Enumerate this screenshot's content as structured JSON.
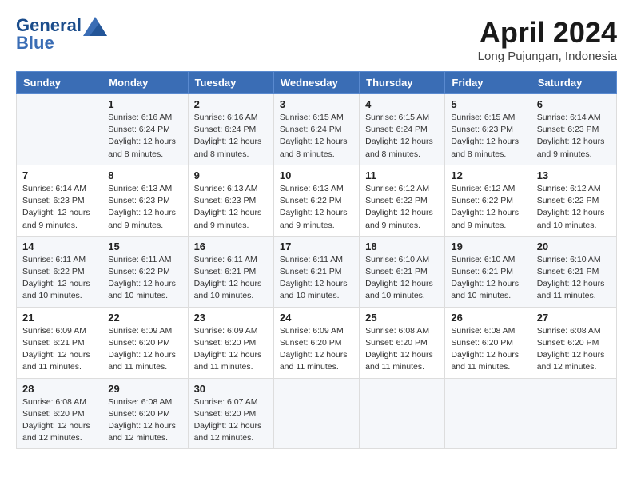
{
  "header": {
    "logo_line1": "General",
    "logo_line2": "Blue",
    "month": "April 2024",
    "location": "Long Pujungan, Indonesia"
  },
  "days_of_week": [
    "Sunday",
    "Monday",
    "Tuesday",
    "Wednesday",
    "Thursday",
    "Friday",
    "Saturday"
  ],
  "weeks": [
    [
      {
        "num": "",
        "info": ""
      },
      {
        "num": "1",
        "info": "Sunrise: 6:16 AM\nSunset: 6:24 PM\nDaylight: 12 hours\nand 8 minutes."
      },
      {
        "num": "2",
        "info": "Sunrise: 6:16 AM\nSunset: 6:24 PM\nDaylight: 12 hours\nand 8 minutes."
      },
      {
        "num": "3",
        "info": "Sunrise: 6:15 AM\nSunset: 6:24 PM\nDaylight: 12 hours\nand 8 minutes."
      },
      {
        "num": "4",
        "info": "Sunrise: 6:15 AM\nSunset: 6:24 PM\nDaylight: 12 hours\nand 8 minutes."
      },
      {
        "num": "5",
        "info": "Sunrise: 6:15 AM\nSunset: 6:23 PM\nDaylight: 12 hours\nand 8 minutes."
      },
      {
        "num": "6",
        "info": "Sunrise: 6:14 AM\nSunset: 6:23 PM\nDaylight: 12 hours\nand 9 minutes."
      }
    ],
    [
      {
        "num": "7",
        "info": "Sunrise: 6:14 AM\nSunset: 6:23 PM\nDaylight: 12 hours\nand 9 minutes."
      },
      {
        "num": "8",
        "info": "Sunrise: 6:13 AM\nSunset: 6:23 PM\nDaylight: 12 hours\nand 9 minutes."
      },
      {
        "num": "9",
        "info": "Sunrise: 6:13 AM\nSunset: 6:23 PM\nDaylight: 12 hours\nand 9 minutes."
      },
      {
        "num": "10",
        "info": "Sunrise: 6:13 AM\nSunset: 6:22 PM\nDaylight: 12 hours\nand 9 minutes."
      },
      {
        "num": "11",
        "info": "Sunrise: 6:12 AM\nSunset: 6:22 PM\nDaylight: 12 hours\nand 9 minutes."
      },
      {
        "num": "12",
        "info": "Sunrise: 6:12 AM\nSunset: 6:22 PM\nDaylight: 12 hours\nand 9 minutes."
      },
      {
        "num": "13",
        "info": "Sunrise: 6:12 AM\nSunset: 6:22 PM\nDaylight: 12 hours\nand 10 minutes."
      }
    ],
    [
      {
        "num": "14",
        "info": "Sunrise: 6:11 AM\nSunset: 6:22 PM\nDaylight: 12 hours\nand 10 minutes."
      },
      {
        "num": "15",
        "info": "Sunrise: 6:11 AM\nSunset: 6:22 PM\nDaylight: 12 hours\nand 10 minutes."
      },
      {
        "num": "16",
        "info": "Sunrise: 6:11 AM\nSunset: 6:21 PM\nDaylight: 12 hours\nand 10 minutes."
      },
      {
        "num": "17",
        "info": "Sunrise: 6:11 AM\nSunset: 6:21 PM\nDaylight: 12 hours\nand 10 minutes."
      },
      {
        "num": "18",
        "info": "Sunrise: 6:10 AM\nSunset: 6:21 PM\nDaylight: 12 hours\nand 10 minutes."
      },
      {
        "num": "19",
        "info": "Sunrise: 6:10 AM\nSunset: 6:21 PM\nDaylight: 12 hours\nand 10 minutes."
      },
      {
        "num": "20",
        "info": "Sunrise: 6:10 AM\nSunset: 6:21 PM\nDaylight: 12 hours\nand 11 minutes."
      }
    ],
    [
      {
        "num": "21",
        "info": "Sunrise: 6:09 AM\nSunset: 6:21 PM\nDaylight: 12 hours\nand 11 minutes."
      },
      {
        "num": "22",
        "info": "Sunrise: 6:09 AM\nSunset: 6:20 PM\nDaylight: 12 hours\nand 11 minutes."
      },
      {
        "num": "23",
        "info": "Sunrise: 6:09 AM\nSunset: 6:20 PM\nDaylight: 12 hours\nand 11 minutes."
      },
      {
        "num": "24",
        "info": "Sunrise: 6:09 AM\nSunset: 6:20 PM\nDaylight: 12 hours\nand 11 minutes."
      },
      {
        "num": "25",
        "info": "Sunrise: 6:08 AM\nSunset: 6:20 PM\nDaylight: 12 hours\nand 11 minutes."
      },
      {
        "num": "26",
        "info": "Sunrise: 6:08 AM\nSunset: 6:20 PM\nDaylight: 12 hours\nand 11 minutes."
      },
      {
        "num": "27",
        "info": "Sunrise: 6:08 AM\nSunset: 6:20 PM\nDaylight: 12 hours\nand 12 minutes."
      }
    ],
    [
      {
        "num": "28",
        "info": "Sunrise: 6:08 AM\nSunset: 6:20 PM\nDaylight: 12 hours\nand 12 minutes."
      },
      {
        "num": "29",
        "info": "Sunrise: 6:08 AM\nSunset: 6:20 PM\nDaylight: 12 hours\nand 12 minutes."
      },
      {
        "num": "30",
        "info": "Sunrise: 6:07 AM\nSunset: 6:20 PM\nDaylight: 12 hours\nand 12 minutes."
      },
      {
        "num": "",
        "info": ""
      },
      {
        "num": "",
        "info": ""
      },
      {
        "num": "",
        "info": ""
      },
      {
        "num": "",
        "info": ""
      }
    ]
  ]
}
